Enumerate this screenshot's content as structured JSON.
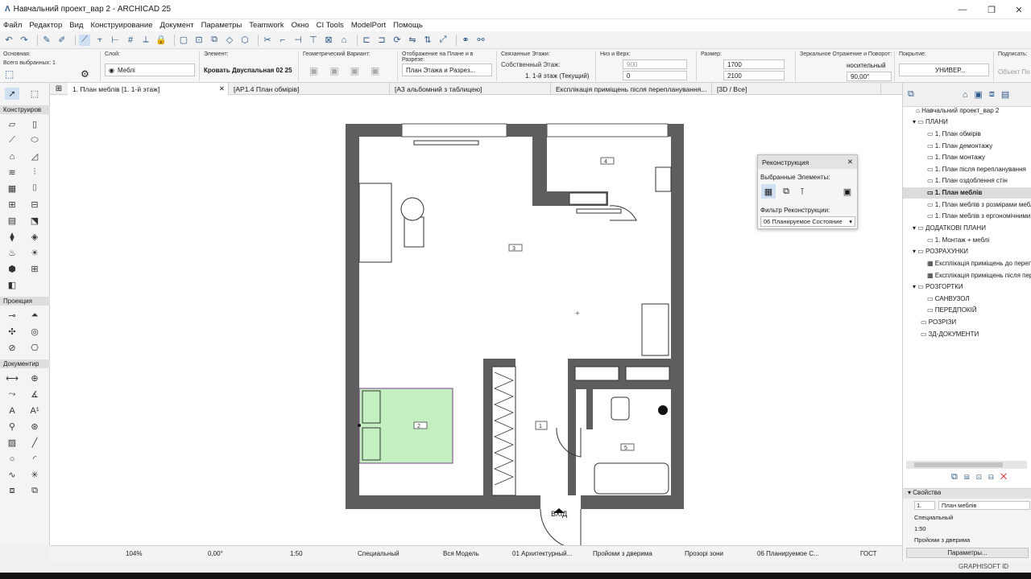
{
  "window": {
    "title": "Навчальний проект_вар 2 - ARCHICAD 25",
    "controls": {
      "minimize": "—",
      "maximize": "❐",
      "close": "✕"
    }
  },
  "menu": [
    "Файл",
    "Редактор",
    "Вид",
    "Конструирование",
    "Документ",
    "Параметры",
    "Teamwork",
    "Окно",
    "CI Tools",
    "ModelPort",
    "Помощь"
  ],
  "infobox": {
    "osnovnaya_label": "Основная:",
    "selected_count": "Всего выбранных: 1",
    "layer_label": "Слой:",
    "layer_value": "Меблі",
    "element_label": "Элемент:",
    "element_value": "Кровать Двуспальная 02 25",
    "geo_label": "Геометрический Вариант:",
    "display_label": "Отображение на Плане и в Разрезе:",
    "display_value": "План Этажа и Разрез...",
    "linked_label": "Связанные Этажи:",
    "own_floor_label": "Собственный Этаж:",
    "own_floor_value": "1. 1-й этаж (Текущий)",
    "bottom_top_label": "Низ и Верх:",
    "bottom_value": "900",
    "top_value": "0",
    "size_label": "Размер:",
    "size_a": "1700",
    "size_b": "2100",
    "mirror_label": "Зеркальное Отражение и Поворот:",
    "mirror_value": "носительный",
    "rotation": "90,00°",
    "surface_label": "Покрытие:",
    "surface_value": "УНИВЕР...",
    "sign_label": "Подписать:",
    "sign_value": "Объект По"
  },
  "tabs": [
    "1. План меблів [1. 1-й этаж]",
    "[АР1.4 План обмірів]",
    "[А3 альбомний з таблицею]",
    "Експлікація приміщень після перепланування...",
    "[3D / Все]"
  ],
  "toolbox": {
    "sections": [
      "Конструиров",
      "Проекция",
      "Документир"
    ]
  },
  "plan": {
    "labels": {
      "zone1": "1",
      "zone2": "2",
      "zone3": "3",
      "zone4": "4",
      "zone5": "5",
      "entry": "ВХІД"
    }
  },
  "reconstruction": {
    "title": "Реконструкция",
    "selected_label": "Выбранные Элементы:",
    "filter_label": "Фильтр Реконструкции:",
    "filter_value": "06 Планируемое Состояние"
  },
  "navigator": {
    "root": "Навчальний проект_вар 2",
    "items": [
      {
        "label": "ПЛАНИ",
        "level": 1,
        "kind": "folder"
      },
      {
        "label": "1. План обмірів",
        "level": 2,
        "kind": "view"
      },
      {
        "label": "1. План демонтажу",
        "level": 2,
        "kind": "view"
      },
      {
        "label": "1. План монтажу",
        "level": 2,
        "kind": "view"
      },
      {
        "label": "1. План після перепланування",
        "level": 2,
        "kind": "view"
      },
      {
        "label": "1. План оздоблення стін",
        "level": 2,
        "kind": "view"
      },
      {
        "label": "1. План меблів",
        "level": 2,
        "kind": "view",
        "selected": true
      },
      {
        "label": "1. План меблів з розмірами меблів",
        "level": 2,
        "kind": "view"
      },
      {
        "label": "1. План меблів з ергономічними",
        "level": 2,
        "kind": "view"
      },
      {
        "label": "ДОДАТКОВІ ПЛАНИ",
        "level": 1,
        "kind": "folder"
      },
      {
        "label": "1. Монтаж + меблі",
        "level": 2,
        "kind": "view"
      },
      {
        "label": "РОЗРАХУНКИ",
        "level": 1,
        "kind": "folder"
      },
      {
        "label": "Експлікація приміщень до перепл",
        "level": 2,
        "kind": "table"
      },
      {
        "label": "Експлікація приміщень після пер",
        "level": 2,
        "kind": "table"
      },
      {
        "label": "РОЗГОРТКИ",
        "level": 1,
        "kind": "folder"
      },
      {
        "label": "САНВУЗОЛ",
        "level": 2,
        "kind": "folder"
      },
      {
        "label": "ПЕРЕДПОКІЙ",
        "level": 2,
        "kind": "folder"
      },
      {
        "label": "РОЗРІЗИ",
        "level": 1,
        "kind": "folder"
      },
      {
        "label": "3Д-ДОКУМЕНТИ",
        "level": 1,
        "kind": "folder"
      }
    ]
  },
  "properties": {
    "title": "Свойства",
    "id_value": "1.",
    "name_value": "План меблів",
    "special": "Специальный",
    "scale": "1:50",
    "openings": "Пройоми з дверима",
    "params_button": "Параметры..."
  },
  "status": {
    "zoom": "104%",
    "angle": "0,00°",
    "scale": "1:50",
    "special": "Специальный",
    "model": "Вся Модель",
    "layers": "01 Архитектурный...",
    "openings": "Пройоми з дверима",
    "zones": "Прозорі зони",
    "recon": "06 Планируемое С...",
    "standard": "ГОСТ"
  },
  "brand": "GRAPHISOFT ID",
  "colors": {
    "wall": "#5e5e5e",
    "selection": "#c4efc0",
    "selection_stroke": "#7a3f8a",
    "accent": "#2d5a8a"
  }
}
